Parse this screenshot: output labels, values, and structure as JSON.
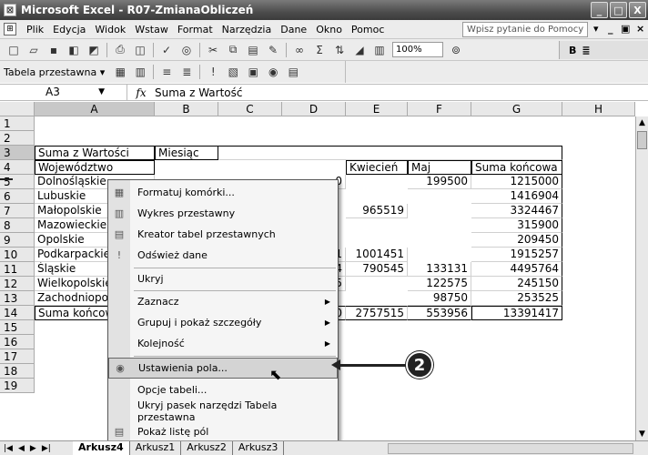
{
  "window": {
    "app_icon": "excel-icon",
    "title": "Microsoft Excel - R07-ZmianaObliczeń",
    "min": "_",
    "max": "□",
    "close": "X"
  },
  "menu": {
    "items": [
      "Plik",
      "Edycja",
      "Widok",
      "Wstaw",
      "Format",
      "Narzędzia",
      "Dane",
      "Okno",
      "Pomoc"
    ],
    "help_placeholder": "Wpisz pytanie do Pomocy",
    "ctrl_min": "_",
    "ctrl_restore": "▣",
    "ctrl_close": "×"
  },
  "toolbar": {
    "zoom": "100%",
    "bold": "B",
    "align": "≣"
  },
  "pivot_toolbar": {
    "label": "Tabela przestawna ▾"
  },
  "formula_bar": {
    "name_box": "A3",
    "fx": "fx",
    "value": "Suma z Wartość"
  },
  "columns": [
    "A",
    "B",
    "C",
    "D",
    "E",
    "F",
    "G",
    "H"
  ],
  "rows": [
    "1",
    "2",
    "3",
    "4",
    "5",
    "6",
    "7",
    "8",
    "9",
    "10",
    "11",
    "12",
    "13",
    "14",
    "15",
    "16",
    "17",
    "18",
    "19"
  ],
  "cells": {
    "a3": "Suma z Wartości",
    "b3": "Miesiąc",
    "a4": "Województwo",
    "e4": "Kwiecień",
    "f4": "Maj",
    "g4": "Suma końcowa",
    "a5": "Dolnośląskie",
    "d5": "0",
    "f5": "199500",
    "g5": "1215000",
    "a6": "Lubuskie",
    "g6": "1416904",
    "a7": "Małopolskie",
    "e7": "965519",
    "g7": "3324467",
    "a8": "Mazowieckie",
    "g8": "315900",
    "a9": "Opolskie",
    "g9": "209450",
    "a10": "Podkarpackie",
    "d10": "1",
    "e10": "1001451",
    "g10": "1915257",
    "a11": "Śląskie",
    "d11": "4",
    "e11": "790545",
    "f11": "133131",
    "g11": "4495764",
    "a12": "Wielkopolskie",
    "d12": "5",
    "f12": "122575",
    "g12": "245150",
    "a13": "Zachodniopomorskie",
    "f13": "98750",
    "g13": "253525",
    "a14": "Suma końcowa",
    "d14": "0",
    "e14": "2757515",
    "f14": "553956",
    "g14": "13391417"
  },
  "context_menu": {
    "items": [
      {
        "label": "Formatuj komórki...",
        "icon": "format-cells-icon"
      },
      {
        "label": "Wykres przestawny",
        "icon": "pivot-chart-icon"
      },
      {
        "label": "Kreator tabel przestawnych",
        "icon": "pivot-wizard-icon"
      },
      {
        "label": "Odśwież dane",
        "icon": "refresh-icon"
      },
      {
        "label": "Ukryj",
        "icon": ""
      },
      {
        "label": "Zaznacz",
        "icon": "",
        "submenu": true
      },
      {
        "label": "Grupuj i pokaż szczegóły",
        "icon": "",
        "submenu": true
      },
      {
        "label": "Kolejność",
        "icon": "",
        "submenu": true
      },
      {
        "label": "Ustawienia pola...",
        "icon": "field-settings-icon",
        "highlighted": true
      },
      {
        "label": "Opcje tabeli...",
        "icon": ""
      },
      {
        "label": "Ukryj pasek narzędzi Tabela przestawna",
        "icon": ""
      },
      {
        "label": "Pokaż listę pól",
        "icon": "field-list-icon"
      }
    ]
  },
  "callout": {
    "number": "2"
  },
  "sheet_tabs": {
    "tabs": [
      "Arkusz4",
      "Arkusz1",
      "Arkusz2",
      "Arkusz3"
    ],
    "active": "Arkusz4"
  }
}
